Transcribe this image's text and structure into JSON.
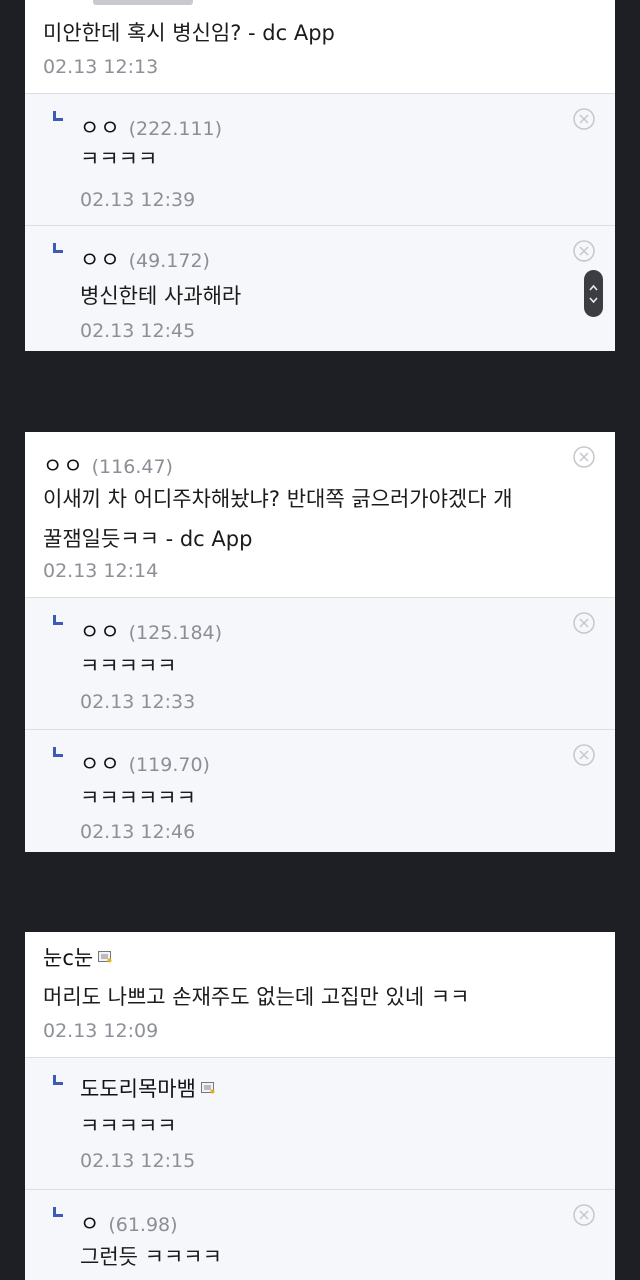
{
  "thread1": {
    "comment": {
      "text": "미안한데 혹시 병신임? - dc App",
      "date": "02.13 12:13"
    },
    "replies": [
      {
        "nick": "ㅇㅇ",
        "ip": "(222.111)",
        "text": "ㅋㅋㅋㅋ",
        "date": "02.13 12:39"
      },
      {
        "nick": "ㅇㅇ",
        "ip": "(49.172)",
        "text": "병신한테 사과해라",
        "date": "02.13 12:45"
      }
    ]
  },
  "thread2": {
    "comment": {
      "nick": "ㅇㅇ",
      "ip": "(116.47)",
      "text_line1": "이새끼 차 어디주차해놨냐? 반대쪽 긁으러가야겠다 개",
      "text_line2": "꿀잼일듯ㅋㅋ - dc App",
      "date": "02.13 12:14"
    },
    "replies": [
      {
        "nick": "ㅇㅇ",
        "ip": "(125.184)",
        "text": "ㅋㅋㅋㅋㅋ",
        "date": "02.13 12:33"
      },
      {
        "nick": "ㅇㅇ",
        "ip": "(119.70)",
        "text": "ㅋㅋㅋㅋㅋㅋ",
        "date": "02.13 12:46"
      }
    ]
  },
  "thread3": {
    "comment": {
      "nick": "눈c눈",
      "text": "머리도 나쁘고 손재주도 없는데 고집만 있네 ㅋㅋ",
      "date": "02.13 12:09"
    },
    "replies": [
      {
        "nick": "도도리목마뱀",
        "text": "ㅋㅋㅋㅋㅋ",
        "date": "02.13 12:15"
      },
      {
        "nick": "ㅇ",
        "ip": "(61.98)",
        "text": "그런듯 ㅋㅋㅋㅋ"
      }
    ]
  },
  "icons": {
    "delete": "circle-x-icon",
    "reply": "reply-hook-icon",
    "gallog": "gallog-badge-icon"
  },
  "colors": {
    "background": "#1e1f24",
    "reply_bg": "#f6f7fa",
    "accent": "#3b5bb5"
  }
}
